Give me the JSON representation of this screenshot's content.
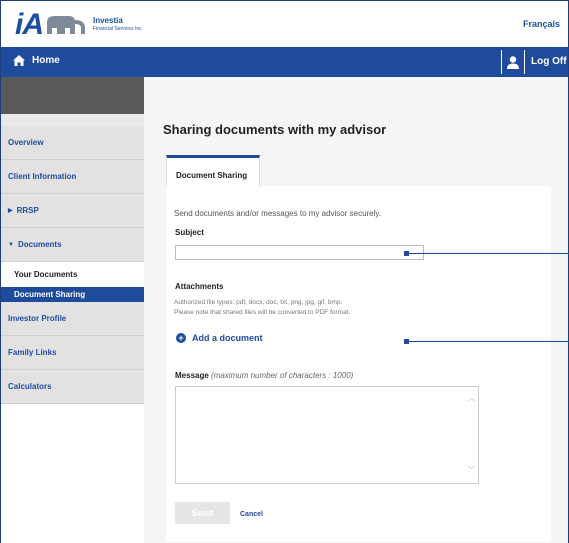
{
  "header": {
    "logo_letters": "iA",
    "logo_line1": "Investia",
    "logo_line2": "Financial Services Inc.",
    "language_link": "Français"
  },
  "navbar": {
    "home_label": "Home",
    "logoff_label": "Log Off"
  },
  "sidebar": {
    "items": [
      {
        "label": "Overview"
      },
      {
        "label": "Client Information"
      },
      {
        "label": "RRSP"
      },
      {
        "label": "Documents"
      },
      {
        "label": "Investor Profile"
      },
      {
        "label": "Family Links"
      },
      {
        "label": "Calculators"
      }
    ],
    "subitems": [
      {
        "label": "Your Documents"
      },
      {
        "label": "Document Sharing"
      }
    ]
  },
  "main": {
    "title": "Sharing documents with my advisor",
    "tab_label": "Document Sharing",
    "intro": "Send documents and/or messages to my advisor securely.",
    "subject_label": "Subject",
    "subject_value": "",
    "attachments_label": "Attachments",
    "attachments_hint1": "Authorized file types: pdf, docx, doc, txt, png, jpg, gif, bmp.",
    "attachments_hint2": "Please note that shared files will be converted to PDF format.",
    "add_document_label": "Add a document",
    "message_label": "Message",
    "message_hint": "(maximum number of characters : 1000)",
    "message_value": "",
    "send_label": "Send",
    "cancel_label": "Cancel"
  },
  "colors": {
    "brand_blue": "#1f4b9c",
    "sidebar_gray": "#e2e2e2",
    "dark_gray": "#595959"
  }
}
